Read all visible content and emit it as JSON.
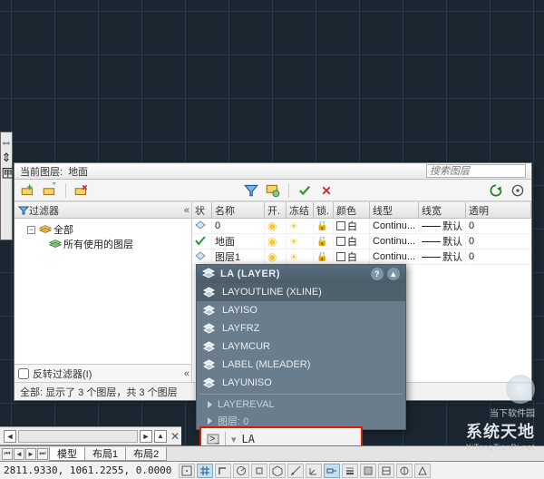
{
  "leftstrip": {
    "arrow_in": "⇔",
    "arrow_out": "⇕",
    "tdlabel": "匣"
  },
  "layer_panel": {
    "title_label": "当前图层:",
    "current_layer": "地面",
    "search_placeholder": "搜索图层",
    "filter_header": "过滤器",
    "filter_collapse": "«",
    "tree": {
      "all": "全部",
      "used": "所有使用的图层"
    },
    "reverse_label": "反转过滤器(I)",
    "reverse_collapse": "«",
    "columns": {
      "status": "状",
      "name": "名称",
      "on": "开.",
      "freeze": "冻结",
      "lock": "锁.",
      "color": "颜色",
      "linetype": "线型",
      "lineweight": "线宽",
      "trans": "透明"
    },
    "rows": [
      {
        "current": false,
        "name": "0",
        "on": true,
        "freeze": false,
        "lock": false,
        "color": "白",
        "linetype": "Continu...",
        "lineweight": "默认",
        "trans": "0"
      },
      {
        "current": true,
        "name": "地面",
        "on": true,
        "freeze": false,
        "lock": false,
        "color": "白",
        "linetype": "Continu...",
        "lineweight": "默认",
        "trans": "0"
      },
      {
        "current": false,
        "name": "图层1",
        "on": true,
        "freeze": false,
        "lock": false,
        "color": "白",
        "linetype": "Continu...",
        "lineweight": "默认",
        "trans": "0"
      }
    ],
    "status_text": "全部: 显示了 3 个图层，共 3 个图层"
  },
  "autocomplete": {
    "title": "LA (LAYER)",
    "help": "?",
    "close": "▲",
    "items": [
      {
        "label": "LAYOUTLINE (XLINE)"
      },
      {
        "label": "LAYISO"
      },
      {
        "label": "LAYFRZ"
      },
      {
        "label": "LAYMCUR"
      },
      {
        "label": "LABEL (MLEADER)"
      },
      {
        "label": "LAYUNISO"
      }
    ],
    "sub1": "LAYEREVAL",
    "sub2": "图层: 0"
  },
  "cmd": {
    "prompt_icon": ">_",
    "text": "LA"
  },
  "cmdline": {
    "left": "◄",
    "right": "►",
    "up": "▲",
    "close": "✕"
  },
  "tabs": {
    "nav_first": "⏮",
    "nav_prev": "◄",
    "nav_next": "►",
    "nav_last": "⏭",
    "items": [
      "模型",
      "布局1",
      "布局2"
    ]
  },
  "statusbar": {
    "coords": "2811.9330, 1061.2255, 0.0000"
  },
  "watermark": {
    "t1": "当下软件园",
    "t2": "系统天地",
    "t3": "XiTongTianDi.net"
  }
}
